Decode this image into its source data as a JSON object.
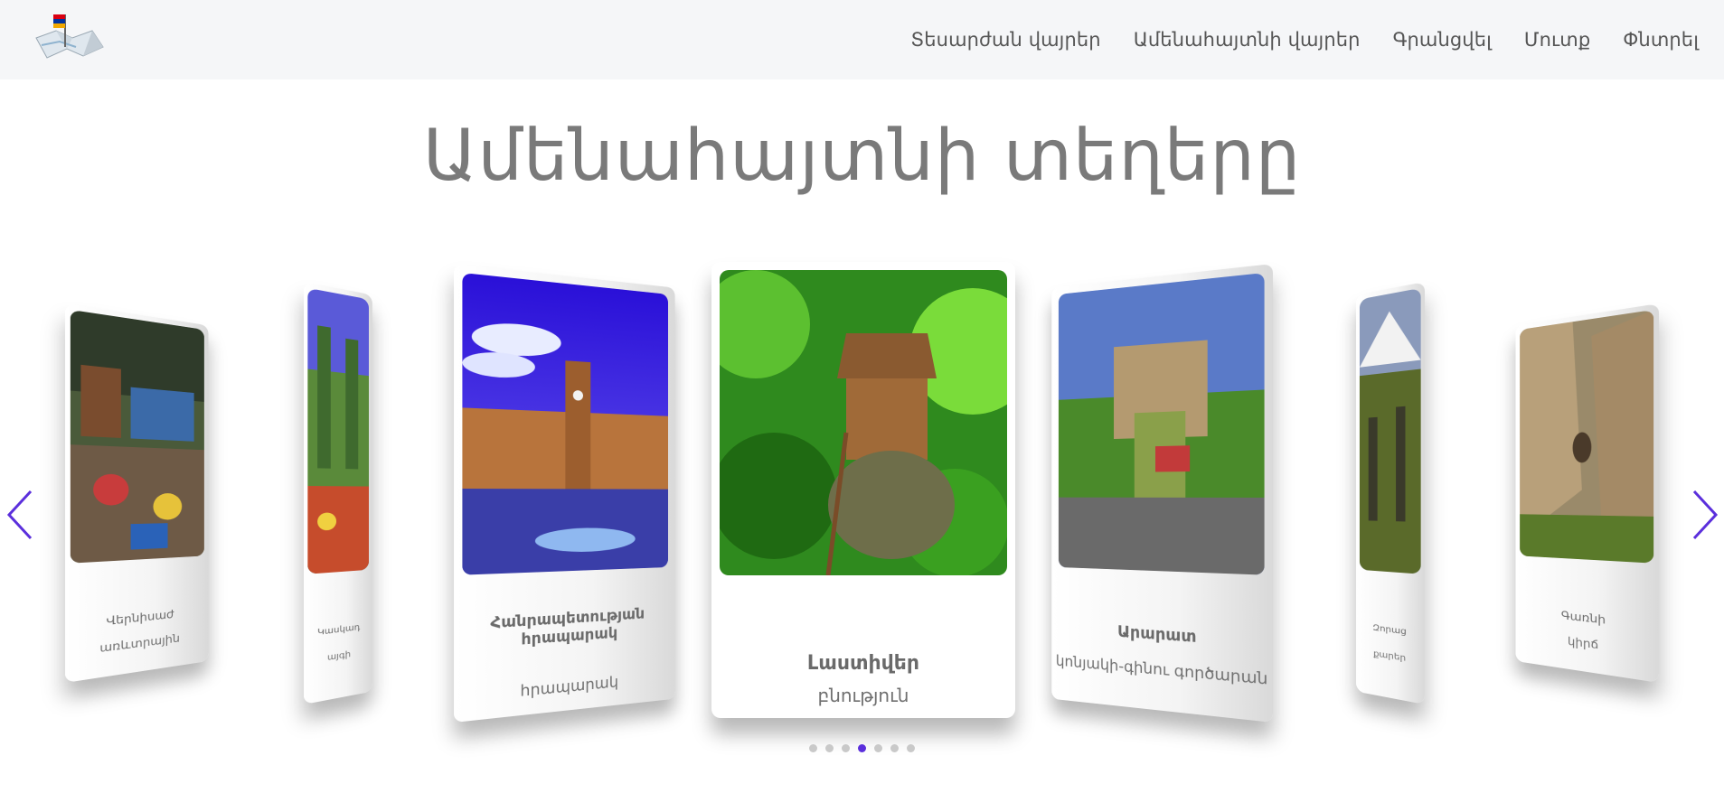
{
  "header": {
    "logo_icon": "armenia-map-flag-icon",
    "nav": [
      {
        "label": "Տեսարժան վայրեր"
      },
      {
        "label": "Ամենահայտնի վայրեր"
      },
      {
        "label": "Գրանցվել"
      },
      {
        "label": "Մուտք"
      },
      {
        "label": "Փնտրել"
      }
    ]
  },
  "main": {
    "title": "Ամենահայտնի տեղերը"
  },
  "carousel": {
    "accent_color": "#5b2fdc",
    "prev_icon": "chevron-left-icon",
    "next_icon": "chevron-right-icon",
    "active_index": 3,
    "dot_count": 7,
    "cards": [
      {
        "name": "Վերնիսաժ",
        "category": "առևտրային"
      },
      {
        "name": "Կասկադ",
        "category": "այգի"
      },
      {
        "name": "Հանրապետության հրապարակ",
        "category": "հրապարակ"
      },
      {
        "name": "Լաստիվեր",
        "category": "բնություն"
      },
      {
        "name": "Արարատ",
        "category": "կոնյակի-գինու գործարան"
      },
      {
        "name": "Զորաց",
        "category": "քարեր"
      },
      {
        "name": "Գառնի",
        "category": "կիրճ"
      }
    ]
  }
}
